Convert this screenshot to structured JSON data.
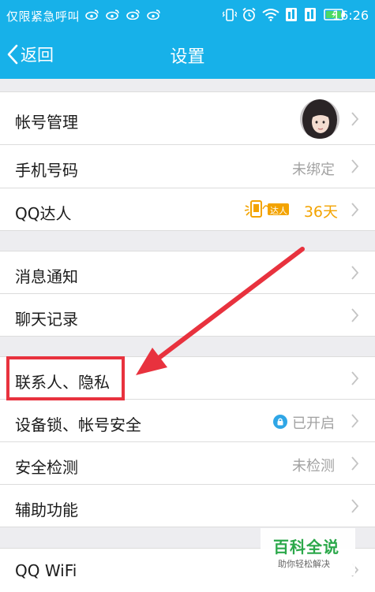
{
  "status_bar": {
    "carrier": "仅限紧急呼叫",
    "time": "16:26"
  },
  "nav": {
    "back_label": "返回",
    "title": "设置"
  },
  "rows": {
    "account": {
      "label": "帐号管理"
    },
    "phone": {
      "label": "手机号码",
      "value": "未绑定"
    },
    "qq_daren": {
      "label": "QQ达人",
      "badge_text": "达人",
      "days": "36天"
    },
    "notifications": {
      "label": "消息通知"
    },
    "chat_history": {
      "label": "聊天记录"
    },
    "privacy": {
      "label": "联系人、隐私"
    },
    "device_lock": {
      "label": "设备锁、帐号安全",
      "value": "已开启"
    },
    "security_check": {
      "label": "安全检测",
      "value": "未检测"
    },
    "accessibility": {
      "label": "辅助功能"
    },
    "qq_wifi": {
      "label": "QQ WiFi"
    }
  },
  "watermark": {
    "title": "百科全说",
    "subtitle": "助你轻松解决"
  },
  "colors": {
    "header_blue": "#17b1e9",
    "annotation_red": "#e8323e",
    "daren_orange": "#f3a300",
    "watermark_green": "#2ba84a"
  }
}
